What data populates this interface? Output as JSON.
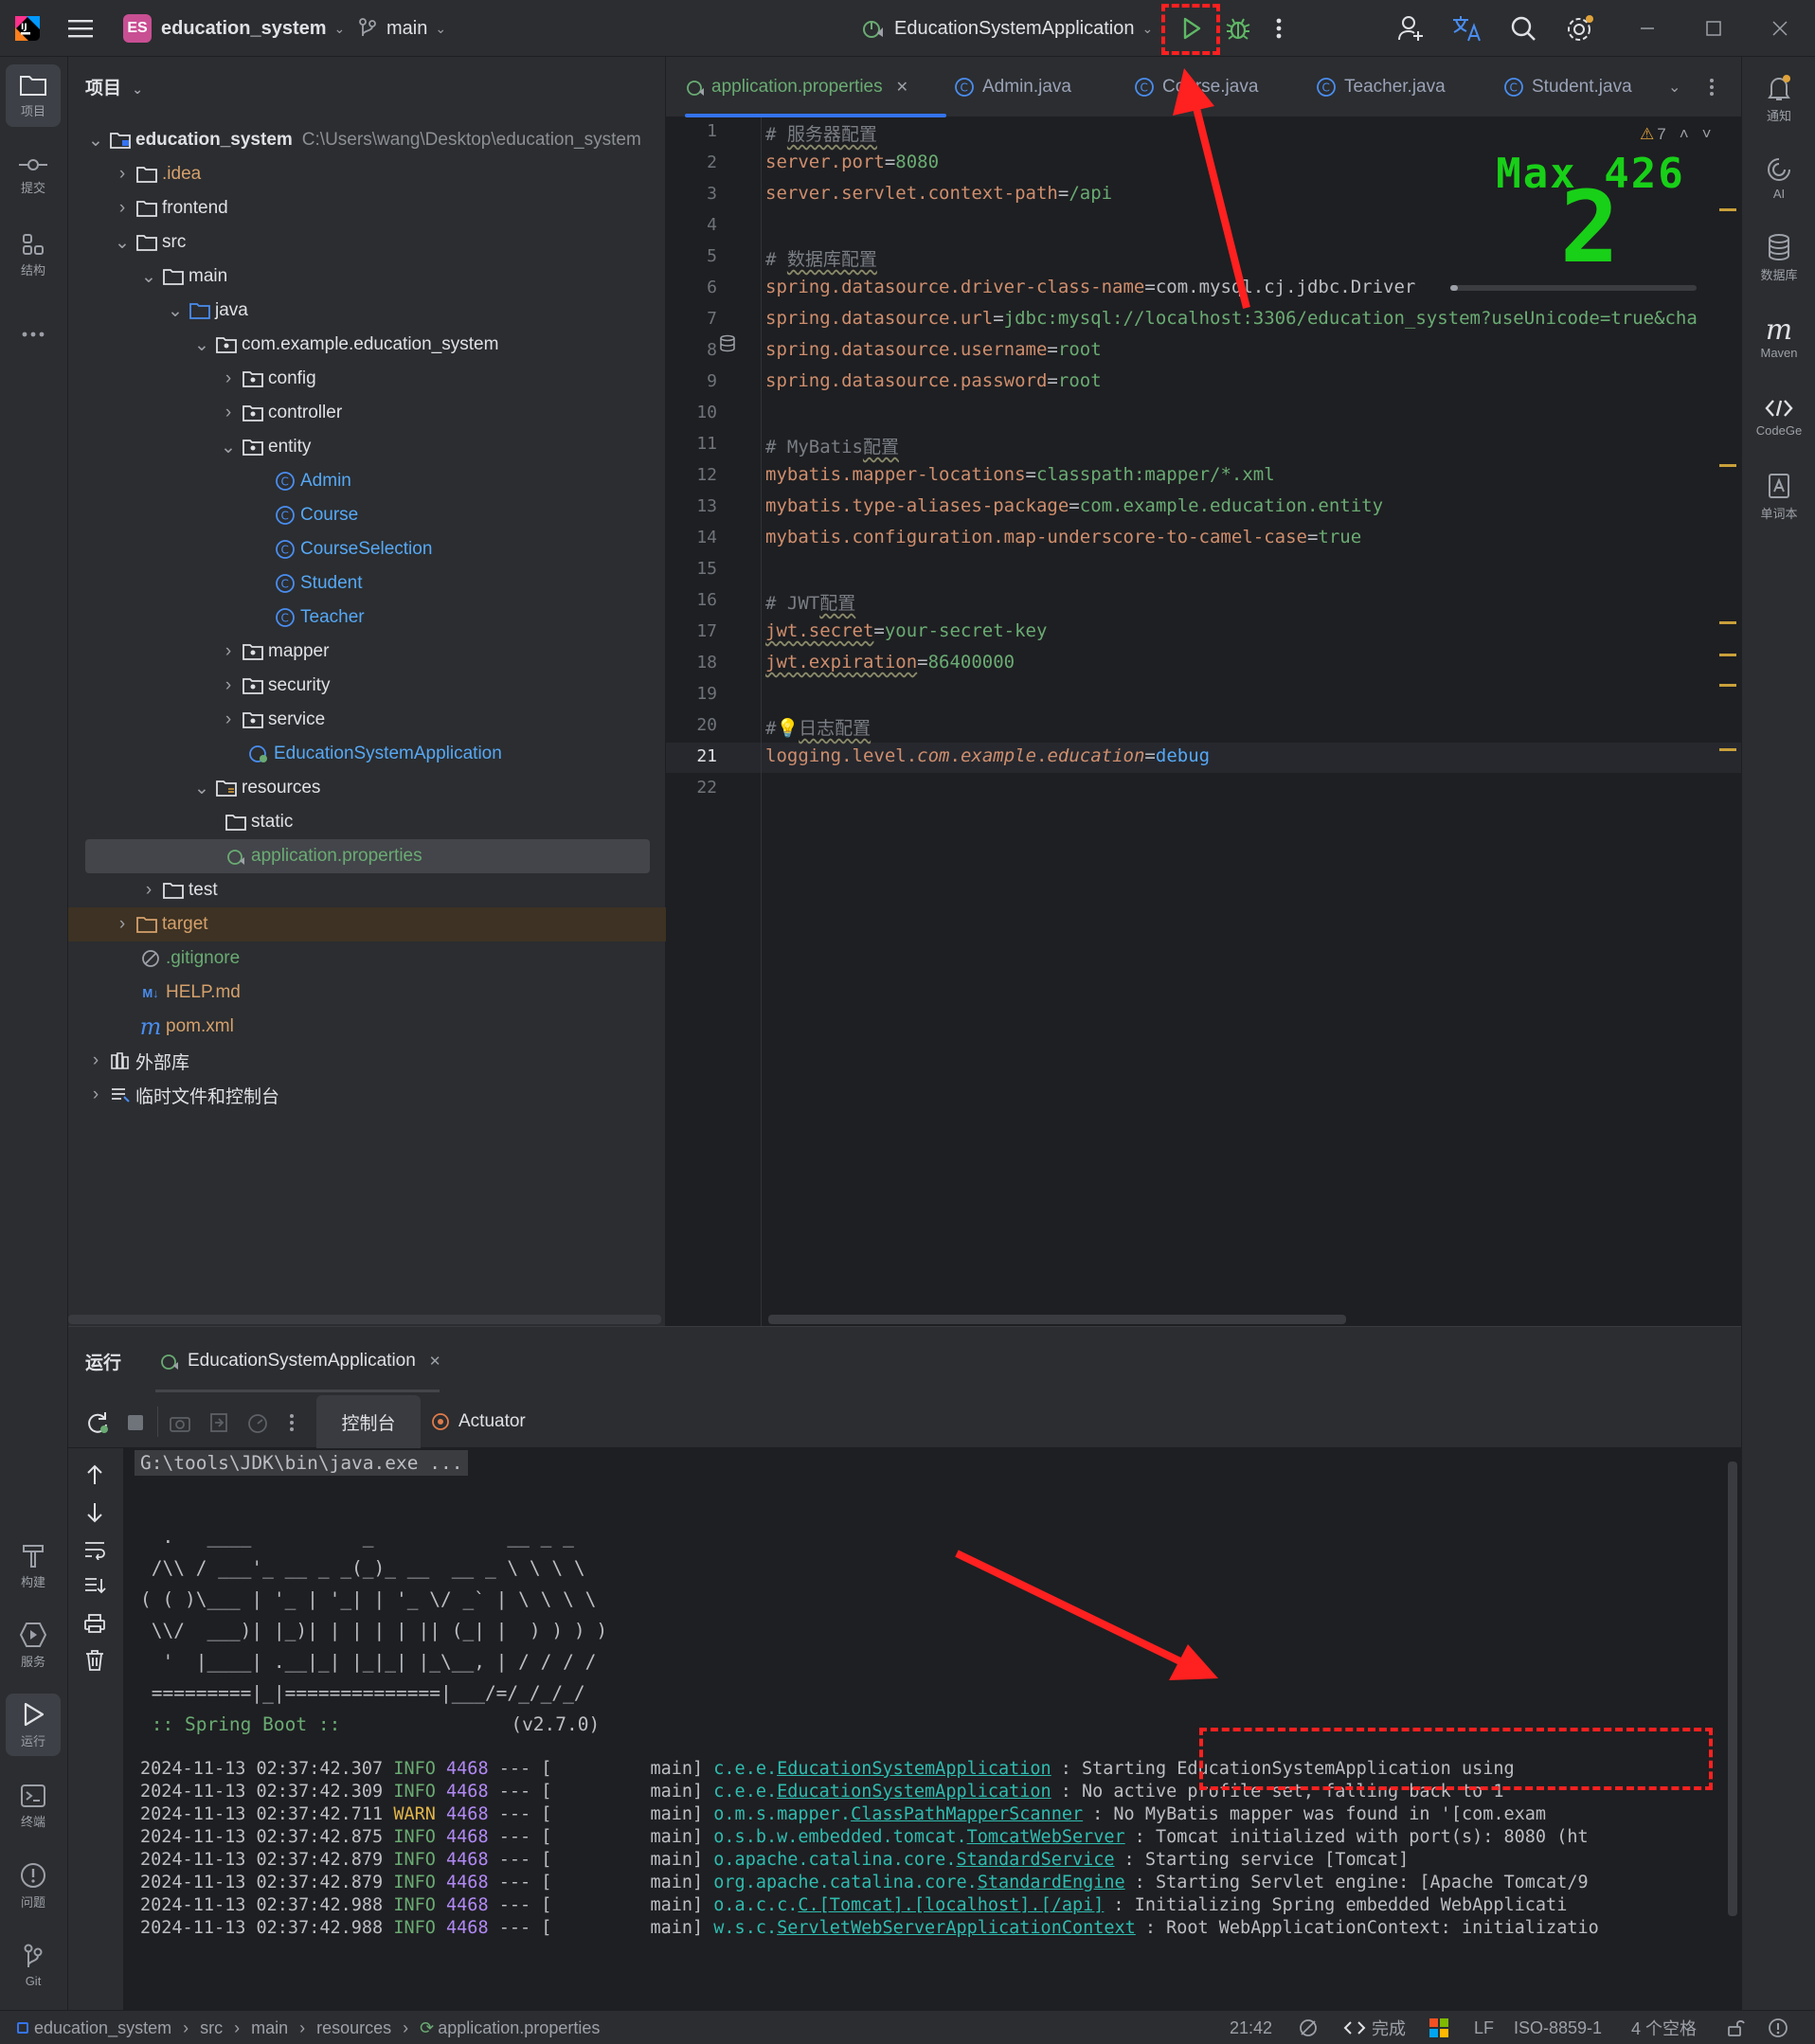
{
  "titlebar": {
    "project_badge": "ES",
    "project_name": "education_system",
    "branch": "main",
    "run_config": "EducationSystemApplication"
  },
  "left_strip": {
    "items": [
      {
        "label": "项目",
        "icon": "folder-icon"
      },
      {
        "label": "提交",
        "icon": "commit-icon"
      },
      {
        "label": "结构",
        "icon": "structure-icon"
      },
      {
        "label": "构建",
        "icon": "hammer-icon"
      },
      {
        "label": "服务",
        "icon": "services-icon"
      },
      {
        "label": "运行",
        "icon": "run-icon"
      },
      {
        "label": "终端",
        "icon": "terminal-icon"
      },
      {
        "label": "问题",
        "icon": "problems-icon"
      },
      {
        "label": "Git",
        "icon": "git-icon"
      }
    ]
  },
  "right_strip": {
    "items": [
      {
        "label": "通知",
        "icon": "bell-icon"
      },
      {
        "label": "AI",
        "icon": "ai-icon"
      },
      {
        "label": "数据库",
        "icon": "database-icon"
      },
      {
        "label": "Maven",
        "icon": "maven-icon"
      },
      {
        "label": "CodeGe",
        "icon": "codegeex-icon"
      },
      {
        "label": "单词本",
        "icon": "wordbook-icon"
      }
    ]
  },
  "project_panel": {
    "title": "项目",
    "root_name": "education_system",
    "root_path": "C:\\Users\\wang\\Desktop\\education_system",
    "nodes": [
      {
        "label": ".idea",
        "color": "#d5a06b"
      },
      {
        "label": "frontend"
      },
      {
        "label": "src"
      },
      {
        "label": "main"
      },
      {
        "label": "java"
      },
      {
        "label": "com.example.education_system"
      },
      {
        "label": "config"
      },
      {
        "label": "controller"
      },
      {
        "label": "entity"
      },
      {
        "label": "Admin"
      },
      {
        "label": "Course"
      },
      {
        "label": "CourseSelection"
      },
      {
        "label": "Student"
      },
      {
        "label": "Teacher"
      },
      {
        "label": "mapper"
      },
      {
        "label": "security"
      },
      {
        "label": "service"
      },
      {
        "label": "EducationSystemApplication"
      },
      {
        "label": "resources"
      },
      {
        "label": "static"
      },
      {
        "label": "application.properties"
      },
      {
        "label": "test"
      },
      {
        "label": "target"
      },
      {
        "label": ".gitignore"
      },
      {
        "label": "HELP.md"
      },
      {
        "label": "pom.xml"
      },
      {
        "label": "外部库"
      },
      {
        "label": "临时文件和控制台"
      }
    ]
  },
  "editor": {
    "tabs": [
      {
        "label": "application.properties"
      },
      {
        "label": "Admin.java"
      },
      {
        "label": "Course.java"
      },
      {
        "label": "Teacher.java"
      },
      {
        "label": "Student.java"
      }
    ],
    "warnings": "7",
    "overlay_max": "Max 426",
    "overlay_num": "2",
    "line_numbers": [
      "1",
      "2",
      "3",
      "4",
      "5",
      "6",
      "7",
      "8",
      "9",
      "10",
      "11",
      "12",
      "13",
      "14",
      "15",
      "16",
      "17",
      "18",
      "19",
      "20",
      "21",
      "22"
    ],
    "lines": {
      "l1_hash": "# ",
      "l1_text": "服务器配置",
      "l2_key": "server.port",
      "l2_eq": "=",
      "l2_val": "8080",
      "l3_key": "server.servlet.context-path",
      "l3_eq": "=",
      "l3_val": "/api",
      "l5_hash": "# ",
      "l5_text": "数据库配置",
      "l6_key": "spring.datasource.driver-class-name",
      "l6_eq": "=",
      "l6_val": "com.mysql.cj.jdbc.Driver",
      "l7_key": "spring.datasource.url",
      "l7_eq": "=",
      "l7_val": "jdbc:mysql://localhost:3306/education_system?useUnicode=true&cha",
      "l8_key": "spring.datasource.username",
      "l8_eq": "=",
      "l8_val": "root",
      "l9_key": "spring.datasource.password",
      "l9_eq": "=",
      "l9_val": "root",
      "l11_hash": "# MyBatis",
      "l11_text": "配置",
      "l12_key": "mybatis.mapper-locations",
      "l12_eq": "=",
      "l12_val": "classpath:mapper/*.xml",
      "l13_key": "mybatis.type-aliases-package",
      "l13_eq": "=",
      "l13_val": "com.example.education.entity",
      "l14_key": "mybatis.configuration.map-underscore-to-camel-case",
      "l14_eq": "=",
      "l14_val": "true",
      "l16_hash": "# JWT",
      "l16_text": "配置",
      "l17_key": "jwt.secret",
      "l17_eq": "=",
      "l17_val": "your-secret-key",
      "l18_key": "jwt.expiration",
      "l18_eq": "=",
      "l18_val": "86400000",
      "l20_hash": "#",
      "l20_text": "日志配置",
      "l21_k1": "logging.level.",
      "l21_k2": "com",
      "l21_k3": ".",
      "l21_k4": "example",
      "l21_k5": ".",
      "l21_k6": "education",
      "l21_eq": "=",
      "l21_val": "debug"
    }
  },
  "run_panel": {
    "title": "运行",
    "tab": "EducationSystemApplication",
    "console_tab": "控制台",
    "actuator_tab": "Actuator",
    "cmd": "G:\\tools\\JDK\\bin\\java.exe ...",
    "banner": [
      "  .   ____          _            __ _ _",
      " /\\\\ / ___'_ __ _ _(_)_ __  __ _ \\ \\ \\ \\",
      "( ( )\\___ | '_ | '_| | '_ \\/ _` | \\ \\ \\ \\",
      " \\\\/  ___)| |_)| | | | | || (_| |  ) ) ) )",
      "  '  |____| .__|_| |_|_| |_\\__, | / / / /",
      " =========|_|==============|___/=/_/_/_/"
    ],
    "spring_label": " :: Spring Boot ::",
    "spring_version": "(v2.7.0)",
    "logs": [
      {
        "ts": "2024-11-13 02:37:42.307",
        "level": "INFO",
        "pid": "4468",
        "sep": "--- [",
        "thread": "main]",
        "pkg": "c.e.e.",
        "cls": "EducationSystemApplication",
        "msg": ": Starting EducationSystemApplication using"
      },
      {
        "ts": "2024-11-13 02:37:42.309",
        "level": "INFO",
        "pid": "4468",
        "sep": "--- [",
        "thread": "main]",
        "pkg": "c.e.e.",
        "cls": "EducationSystemApplication",
        "msg": ": No active profile set, falling back to 1"
      },
      {
        "ts": "2024-11-13 02:37:42.711",
        "level": "WARN",
        "pid": "4468",
        "sep": "--- [",
        "thread": "main]",
        "pkg": "o.m.s.mapper.",
        "cls": "ClassPathMapperScanner",
        "msg": ": No MyBatis mapper was found in '[com.exam"
      },
      {
        "ts": "2024-11-13 02:37:42.875",
        "level": "INFO",
        "pid": "4468",
        "sep": "--- [",
        "thread": "main]",
        "pkg": "o.s.b.w.embedded.tomcat.",
        "cls": "TomcatWebServer",
        "msg": ": Tomcat initialized with port(s): 8080 (ht"
      },
      {
        "ts": "2024-11-13 02:37:42.879",
        "level": "INFO",
        "pid": "4468",
        "sep": "--- [",
        "thread": "main]",
        "pkg": "o.apache.catalina.core.",
        "cls": "StandardService",
        "msg": ": Starting service [Tomcat]"
      },
      {
        "ts": "2024-11-13 02:37:42.879",
        "level": "INFO",
        "pid": "4468",
        "sep": "--- [",
        "thread": "main]",
        "pkg": "org.apache.catalina.core.",
        "cls": "StandardEngine",
        "msg": ": Starting Servlet engine: [Apache Tomcat/9"
      },
      {
        "ts": "2024-11-13 02:37:42.988",
        "level": "INFO",
        "pid": "4468",
        "sep": "--- [",
        "thread": "main]",
        "pkg": "o.a.c.c.",
        "cls": "C.[Tomcat].[localhost].[/api]",
        "msg": ": Initializing Spring embedded WebApplicati"
      },
      {
        "ts": "2024-11-13 02:37:42.988",
        "level": "INFO",
        "pid": "4468",
        "sep": "--- [",
        "thread": "main]",
        "pkg": "w.s.c.",
        "cls": "ServletWebServerApplicationContext",
        "msg": ": Root WebApplicationContext: initializatio"
      }
    ]
  },
  "statusbar": {
    "crumbs": [
      "education_system",
      "src",
      "main",
      "resources",
      "application.properties"
    ],
    "position": "21:42",
    "status": "完成",
    "line_sep": "LF",
    "encoding": "ISO-8859-1",
    "indent": "4 个空格"
  },
  "colors": {
    "accent": "#3574f0",
    "annotation": "#ff2020",
    "spring_green": "#6aab73"
  }
}
